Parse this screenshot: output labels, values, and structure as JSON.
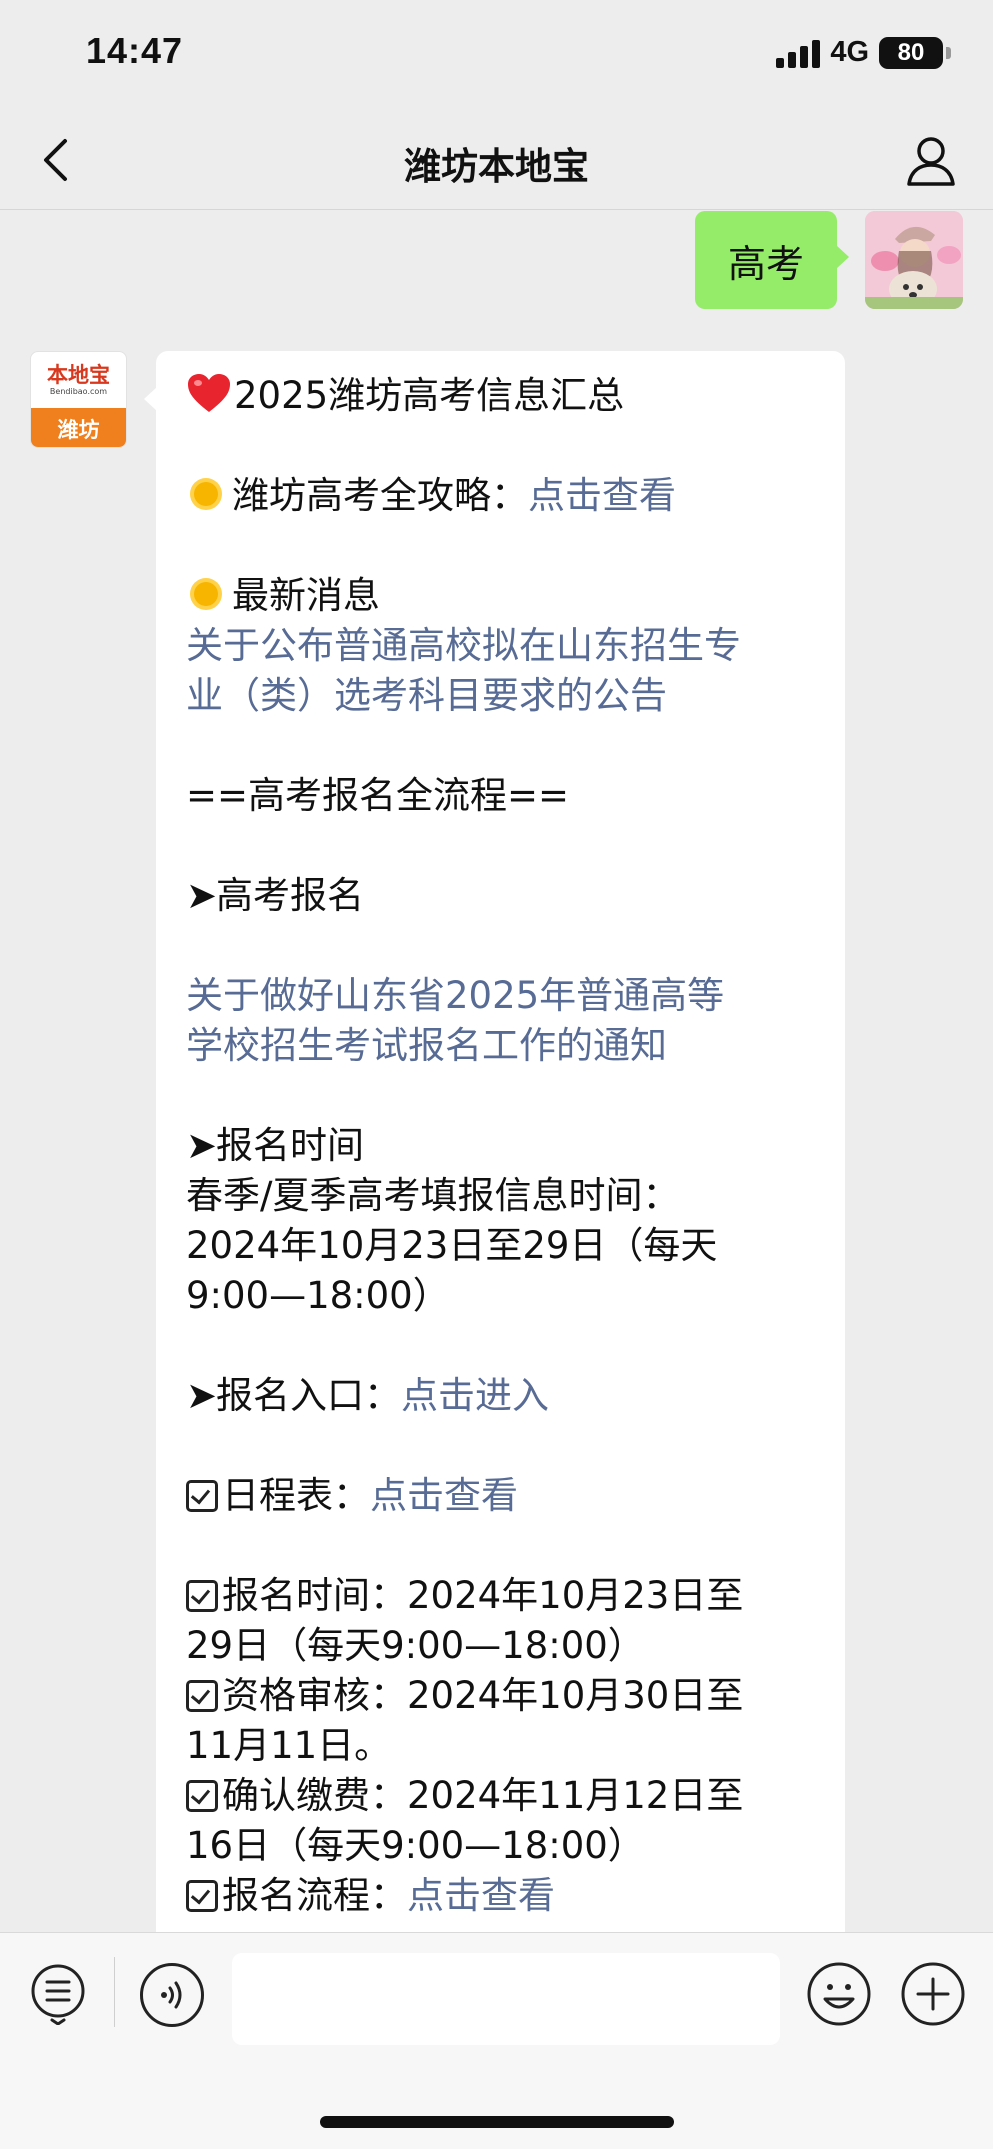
{
  "status_bar": {
    "time": "14:47",
    "network": "4G",
    "battery": "80"
  },
  "nav": {
    "title": "潍坊本地宝"
  },
  "user_message": {
    "text": "高考"
  },
  "bot_avatar": {
    "brand": "本地宝",
    "brand_sub": "Bendibao.com",
    "city": "潍坊"
  },
  "bot_message": {
    "title": "2025潍坊高考信息汇总",
    "guide_label": "潍坊高考全攻略：",
    "guide_link": "点击查看",
    "news_label": "最新消息",
    "news_link_1": "关于公布普通高校拟在山东招生专",
    "news_link_2": "业（类）选考科目要求的公告",
    "process_header": "==高考报名全流程==",
    "register_label": "高考报名",
    "notice_link_1": "关于做好山东省2025年普通高等",
    "notice_link_2": "学校招生考试报名工作的通知",
    "time_label": "报名时间",
    "time_line_1": "春季/夏季高考填报信息时间：",
    "time_line_2": "2024年10月23日至29日（每天",
    "time_line_3": "9:00—18:00）",
    "entry_label": "报名入口：",
    "entry_link": "点击进入",
    "schedule_label": "日程表：",
    "schedule_link": "点击查看",
    "item1_line1": "报名时间：2024年10月23日至",
    "item1_line2": "29日（每天9:00—18:00）",
    "item2_line1": "资格审核：2024年10月30日至",
    "item2_line2": "11月11日。",
    "item3_line1": "确认缴费：2024年11月12日至",
    "item3_line2": "16日（每天9:00—18:00）",
    "item4_label": "报名流程：",
    "item4_link": "点击查看"
  },
  "input": {
    "placeholder": ""
  },
  "colors": {
    "link": "#576b95",
    "user_bubble": "#95ec69",
    "background": "#ededed"
  }
}
